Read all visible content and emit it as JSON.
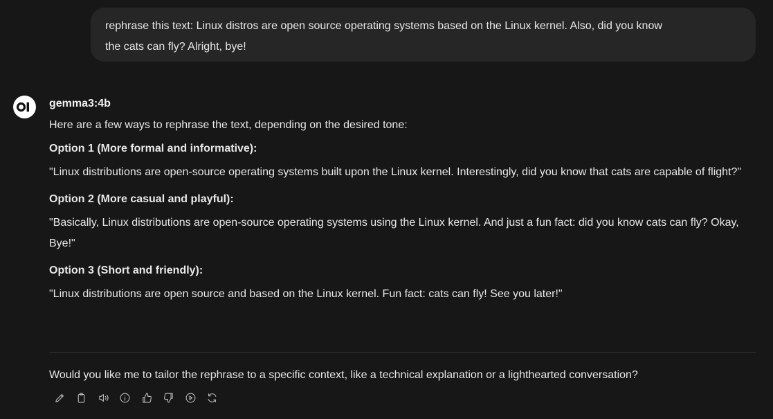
{
  "user_message": {
    "line1": "rephrase this text: Linux distros are open source operating systems based on the Linux kernel. Also, did you know",
    "line2": "the cats can fly? Alright, bye!"
  },
  "assistant": {
    "avatar_text": "OI",
    "model_name": "gemma3:4b",
    "intro": "Here are a few ways to rephrase the text, depending on the desired tone:",
    "options": [
      {
        "heading": "Option 1 (More formal and informative):",
        "text": "\"Linux distributions are open-source operating systems built upon the Linux kernel. Interestingly, did you know that cats are capable of flight?\""
      },
      {
        "heading": "Option 2 (More casual and playful):",
        "text": "\"Basically, Linux distributions are open-source operating systems using the Linux kernel. And just a fun fact: did you know cats can fly? Okay, Bye!\""
      },
      {
        "heading": "Option 3 (Short and friendly):",
        "text": "\"Linux distributions are open source and based on the Linux kernel. Fun fact: cats can fly! See you later!\""
      }
    ],
    "followup": "Would you like me to tailor the rephrase to a specific context, like a technical explanation or a lighthearted conversation?"
  },
  "toolbar": {
    "icons": [
      "edit-icon",
      "copy-icon",
      "read-aloud-icon",
      "info-icon",
      "thumbs-up-icon",
      "thumbs-down-icon",
      "continue-icon",
      "regenerate-icon"
    ],
    "icon_color": "#b4b4b4"
  },
  "colors": {
    "background": "#171717",
    "user_bubble": "#262626",
    "text": "#e8e8e8"
  }
}
